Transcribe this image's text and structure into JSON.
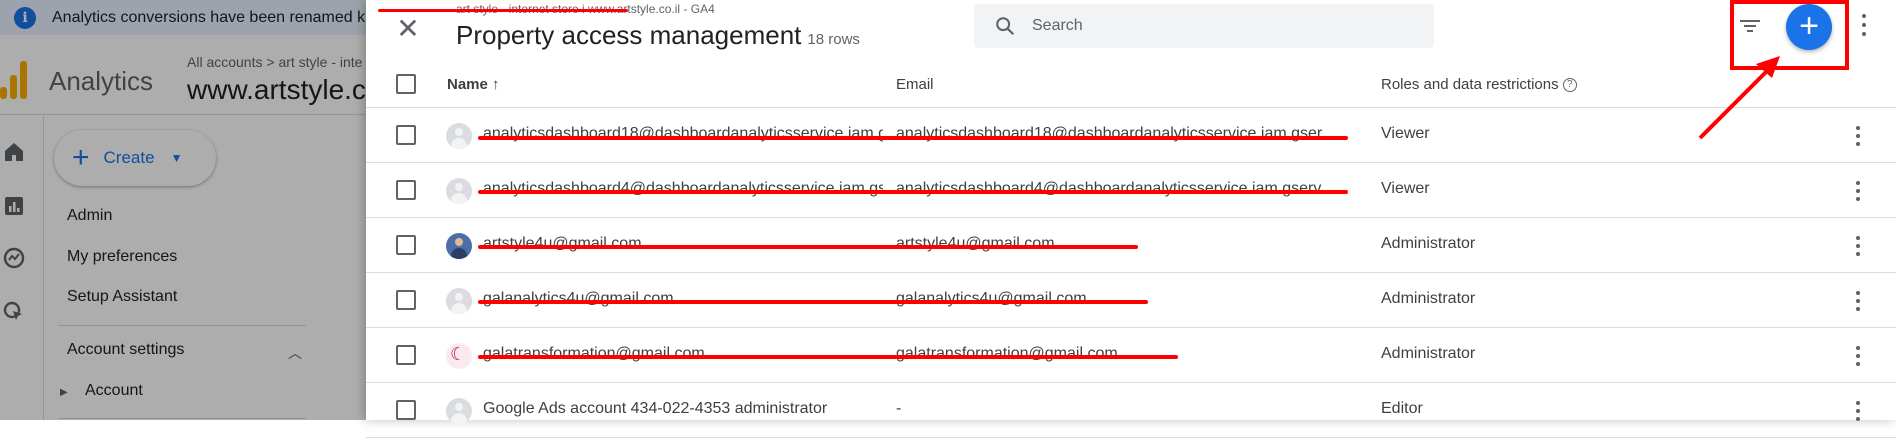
{
  "banner": {
    "text": "Analytics conversions have been renamed k"
  },
  "app": {
    "brand": "Analytics",
    "breadcrumb": "All accounts > art style - inte",
    "account": "www.artstyle.co"
  },
  "leftnav": {
    "create_label": "Create",
    "items": [
      "Admin",
      "My preferences",
      "Setup Assistant"
    ],
    "section": "Account settings",
    "subitem": "Account"
  },
  "panel": {
    "subtitle": "art style - internet store i www.artstyle.co.il - GA4",
    "title": "Property access management",
    "row_count": "18 rows",
    "search_placeholder": "Search",
    "columns": {
      "name": "Name",
      "sort_arrow": "↑",
      "email": "Email",
      "roles": "Roles and data restrictions"
    },
    "rows": [
      {
        "name": "analyticsdashboard18@dashboardanalyticsservice.iam.g",
        "email": "analyticsdashboard18@dashboardanalyticsservice.iam.gser…",
        "role": "Viewer",
        "avatar": "generic"
      },
      {
        "name": "analyticsdashboard4@dashboardanalyticsservice.iam.gs",
        "email": "analyticsdashboard4@dashboardanalyticsservice.iam.gserv…",
        "role": "Viewer",
        "avatar": "generic"
      },
      {
        "name": "artstyle4u@gmail.com",
        "email": "artstyle4u@gmail.com",
        "role": "Administrator",
        "avatar": "photo"
      },
      {
        "name": "galanalytics4u@gmail.com",
        "email": "galanalytics4u@gmail.com",
        "role": "Administrator",
        "avatar": "generic"
      },
      {
        "name": "galatransformation@gmail.com",
        "email": "galatransformation@gmail.com",
        "role": "Administrator",
        "avatar": "moon"
      },
      {
        "name": "Google Ads account 434-022-4353 administrator",
        "email": "-",
        "role": "Editor",
        "avatar": "generic"
      }
    ]
  },
  "colors": {
    "accent": "#1a73e8",
    "annotation": "#ff0000"
  }
}
